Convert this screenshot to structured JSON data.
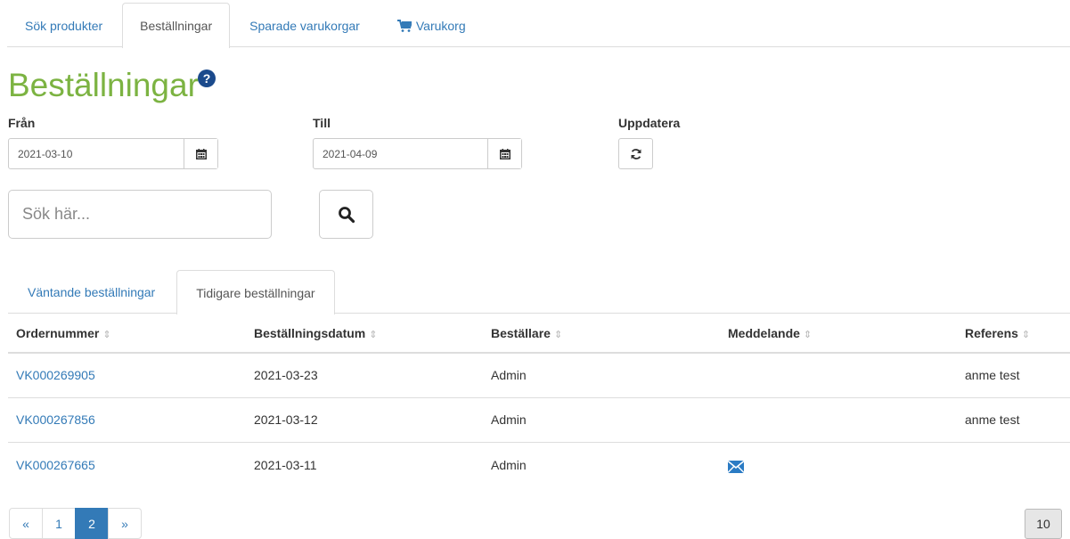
{
  "top_tabs": [
    {
      "label": "Sök produkter"
    },
    {
      "label": "Beställningar"
    },
    {
      "label": "Sparade varukorgar"
    },
    {
      "label": "Varukorg",
      "icon": "cart-icon"
    }
  ],
  "page": {
    "title": "Beställningar",
    "help_icon": "?"
  },
  "filters": {
    "from_label": "Från",
    "from_value": "2021-03-10",
    "to_label": "Till",
    "to_value": "2021-04-09",
    "update_label": "Uppdatera"
  },
  "search": {
    "placeholder": "Sök här..."
  },
  "sub_tabs": [
    {
      "label": "Väntande beställningar"
    },
    {
      "label": "Tidigare beställningar"
    }
  ],
  "table": {
    "headers": [
      "Ordernummer",
      "Beställningsdatum",
      "Beställare",
      "Meddelande",
      "Referens"
    ],
    "sort_glyph": "⇕",
    "rows": [
      {
        "order": "VK000269905",
        "date": "2021-03-23",
        "orderer": "Admin",
        "message_icon": "",
        "reference": "anme test"
      },
      {
        "order": "VK000267856",
        "date": "2021-03-12",
        "orderer": "Admin",
        "message_icon": "",
        "reference": "anme test"
      },
      {
        "order": "VK000267665",
        "date": "2021-03-11",
        "orderer": "Admin",
        "message_icon": "envelope-icon",
        "reference": ""
      }
    ]
  },
  "pagination": {
    "prev": "«",
    "pages": [
      "1",
      "2"
    ],
    "current": "2",
    "next": "»",
    "page_size": "10"
  },
  "colors": {
    "title_green": "#7cb342",
    "link_blue": "#337ab7",
    "help_icon_blue": "#1b4a8c",
    "envelope_blue": "#2b7bc4"
  }
}
